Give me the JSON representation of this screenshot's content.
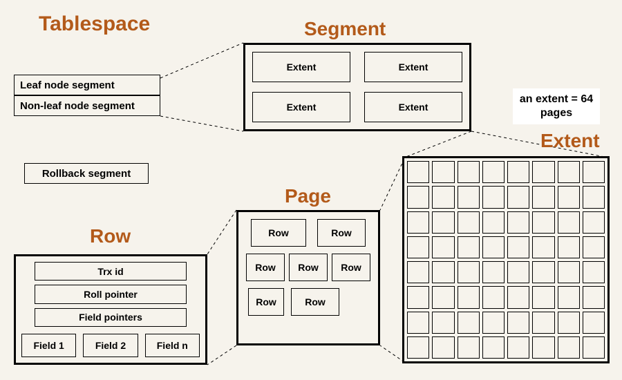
{
  "headings": {
    "tablespace": "Tablespace",
    "segment": "Segment",
    "extent": "Extent",
    "page": "Page",
    "row": "Row"
  },
  "tablespace": {
    "leaf": "Leaf node segment",
    "nonleaf": "Non-leaf node segment",
    "rollback": "Rollback segment"
  },
  "segment": {
    "extents": [
      "Extent",
      "Extent",
      "Extent",
      "Extent"
    ]
  },
  "extent_note": "an extent = 64 pages",
  "extent_grid": {
    "rows": 8,
    "cols": 8
  },
  "page": {
    "rows": [
      "Row",
      "Row",
      "Row",
      "Row",
      "Row",
      "Row",
      "Row"
    ]
  },
  "row": {
    "trx": "Trx id",
    "roll": "Roll pointer",
    "fieldptrs": "Field pointers",
    "fields": [
      "Field 1",
      "Field 2",
      "Field n"
    ]
  },
  "colors": {
    "accent": "#b35a1a",
    "bg": "#f6f3ec"
  }
}
